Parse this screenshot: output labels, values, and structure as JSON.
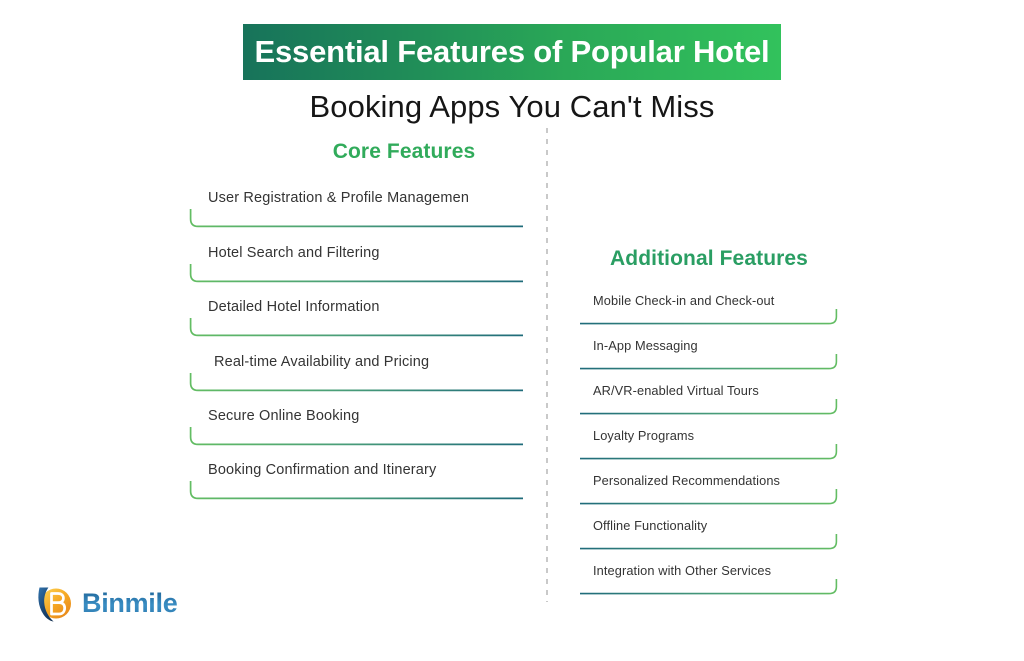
{
  "title": {
    "banner_text": "Essential Features of Popular Hotel",
    "line2_text": "Booking Apps You Can't Miss",
    "banner_gradient_start": "#17735a",
    "banner_gradient_end": "#32c25c",
    "line2_color": "#161616"
  },
  "core": {
    "heading": "Core Features",
    "heading_color": "#31ab5b",
    "items": [
      {
        "label": "User Registration & Profile Managemen"
      },
      {
        "label": "Hotel Search and Filtering"
      },
      {
        "label": "Detailed Hotel Information"
      },
      {
        "label": "Real-time Availability and Pricing"
      },
      {
        "label": "Secure Online Booking"
      },
      {
        "label": "Booking Confirmation and Itinerary"
      }
    ]
  },
  "additional": {
    "heading": "Additional Features",
    "heading_color": "#2a9e63",
    "items": [
      {
        "label": "Mobile Check-in and Check-out"
      },
      {
        "label": "In-App Messaging"
      },
      {
        "label": "AR/VR-enabled Virtual Tours"
      },
      {
        "label": "Loyalty Programs"
      },
      {
        "label": "Personalized Recommendations"
      },
      {
        "label": "Offline Functionality"
      },
      {
        "label": "Integration with Other Services"
      }
    ]
  },
  "logo": {
    "wordmark": "Binmile",
    "wordmark_color": "#2b7bb9",
    "mark_orange": "#f5a623",
    "mark_navy": "#1b3a5c"
  },
  "theme": {
    "background": "#ffffff",
    "rule_green": "#5cb85c",
    "rule_teal": "#1f6b7a",
    "item_text": "#343434",
    "divider_color": "#c9c9c9"
  }
}
